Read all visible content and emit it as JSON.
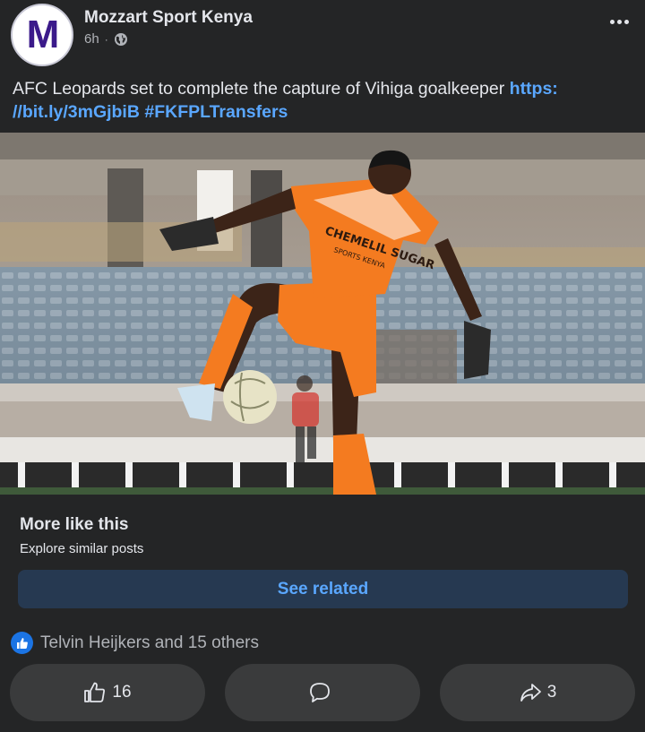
{
  "post": {
    "page_name": "Mozzart Sport Kenya",
    "avatar_letter": "M",
    "time": "6h",
    "dot": "·",
    "text": "AFC Leopards set to complete the capture of Vihiga goalkeeper ",
    "link": "https:\n//bit.ly/3mGjbiB",
    "hashtag": "#FKFPLTransfers",
    "jersey_text": "CHEMELIL SUGAR",
    "jersey_subtext": "SPORTS KENYA"
  },
  "more_like_this": {
    "title": "More like this",
    "subtitle": "Explore similar posts",
    "button": "See related"
  },
  "reactions": {
    "text": "Telvin Heijkers and 15 others"
  },
  "actions": {
    "like_count": "16",
    "comment_count": "",
    "share_count": "3"
  },
  "colors": {
    "background": "#242526",
    "link": "#5aa7ff",
    "button_bg": "#263951",
    "action_bg": "#3a3b3c",
    "like_badge": "#1b74e4",
    "jersey": "#f47b20"
  },
  "icons": [
    "globe-icon",
    "more-options-icon",
    "like-badge-icon",
    "thumbs-up-icon",
    "comment-icon",
    "share-icon"
  ]
}
